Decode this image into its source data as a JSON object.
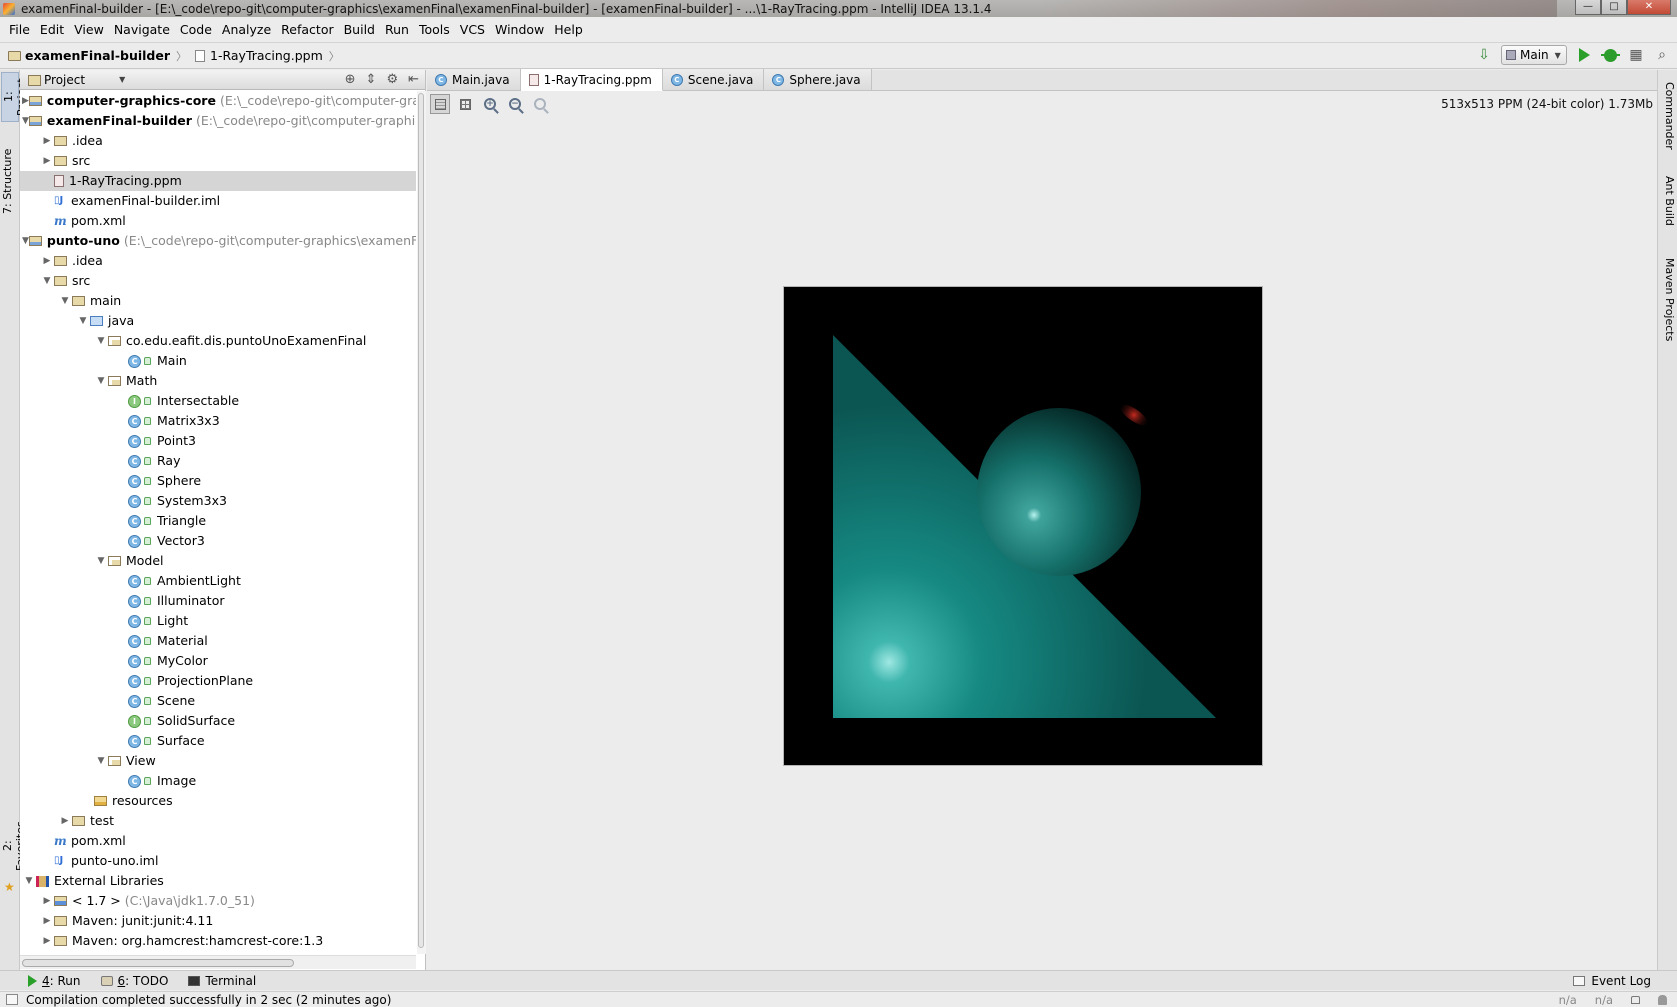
{
  "window": {
    "title": "examenFinal-builder - [E:\\_code\\repo-git\\computer-graphics\\examenFinal\\examenFinal-builder] - [examenFinal-builder] - ...\\1-RayTracing.ppm - IntelliJ IDEA 13.1.4",
    "controls": {
      "minimize": "—",
      "maximize": "□",
      "close": "✕"
    }
  },
  "menu": [
    "File",
    "Edit",
    "View",
    "Navigate",
    "Code",
    "Analyze",
    "Refactor",
    "Build",
    "Run",
    "Tools",
    "VCS",
    "Window",
    "Help"
  ],
  "breadcrumb": {
    "project": "examenFinal-builder",
    "file": "1-RayTracing.ppm"
  },
  "toolbar": {
    "run_config": "Main"
  },
  "left_stripe": {
    "project_tab": "1: Project",
    "structure_tab": "7: Structure",
    "favorites_tab": "2: Favorites"
  },
  "right_stripe": {
    "commander": "Commander",
    "ant_build": "Ant Build",
    "maven_projects": "Maven Projects"
  },
  "project_panel": {
    "title": "Project",
    "tree": [
      {
        "label": "computer-graphics-core",
        "path": "(E:\\_code\\repo-git\\computer-graphics\\sc",
        "bold": true
      },
      {
        "label": "examenFinal-builder",
        "path": "(E:\\_code\\repo-git\\computer-graphics\\exam",
        "bold": true
      },
      {
        "label": ".idea"
      },
      {
        "label": "src"
      },
      {
        "label": "1-RayTracing.ppm"
      },
      {
        "label": "examenFinal-builder.iml"
      },
      {
        "label": "pom.xml"
      },
      {
        "label": "punto-uno",
        "path": "(E:\\_code\\repo-git\\computer-graphics\\examenFinal\\pu",
        "bold": true
      },
      {
        "label": ".idea"
      },
      {
        "label": "src"
      },
      {
        "label": "main"
      },
      {
        "label": "java"
      },
      {
        "label": "co.edu.eafit.dis.puntoUnoExamenFinal"
      },
      {
        "label": "Main"
      },
      {
        "label": "Math"
      },
      {
        "label": "Intersectable"
      },
      {
        "label": "Matrix3x3"
      },
      {
        "label": "Point3"
      },
      {
        "label": "Ray"
      },
      {
        "label": "Sphere"
      },
      {
        "label": "System3x3"
      },
      {
        "label": "Triangle"
      },
      {
        "label": "Vector3"
      },
      {
        "label": "Model"
      },
      {
        "label": "AmbientLight"
      },
      {
        "label": "Illuminator"
      },
      {
        "label": "Light"
      },
      {
        "label": "Material"
      },
      {
        "label": "MyColor"
      },
      {
        "label": "ProjectionPlane"
      },
      {
        "label": "Scene"
      },
      {
        "label": "SolidSurface"
      },
      {
        "label": "Surface"
      },
      {
        "label": "View"
      },
      {
        "label": "Image"
      },
      {
        "label": "resources"
      },
      {
        "label": "test"
      },
      {
        "label": "pom.xml"
      },
      {
        "label": "punto-uno.iml"
      },
      {
        "label": "External Libraries"
      },
      {
        "label": "< 1.7 >",
        "path": "(C:\\Java\\jdk1.7.0_51)"
      },
      {
        "label": "Maven: junit:junit:4.11"
      },
      {
        "label": "Maven: org.hamcrest:hamcrest-core:1.3"
      }
    ]
  },
  "editor": {
    "tabs": [
      "Main.java",
      "1-RayTracing.ppm",
      "Scene.java",
      "Sphere.java"
    ],
    "active_tab": "1-RayTracing.ppm",
    "image_info": "513x513 PPM (24-bit color) 1.73Mb",
    "image_colors": {
      "background": "#000000",
      "surface": "#0f6f6a",
      "highlight": "#9fe8e3",
      "red_highlight": "#b1231a"
    }
  },
  "bottom_tabs": {
    "run_num": "4",
    "run": ": Run",
    "todo_num": "6",
    "todo": ": TODO",
    "terminal": "Terminal",
    "event_log": "Event Log"
  },
  "status": {
    "message": "Compilation completed successfully in 2 sec (2 minutes ago)",
    "pos1": "n/a",
    "pos2": "n/a"
  }
}
